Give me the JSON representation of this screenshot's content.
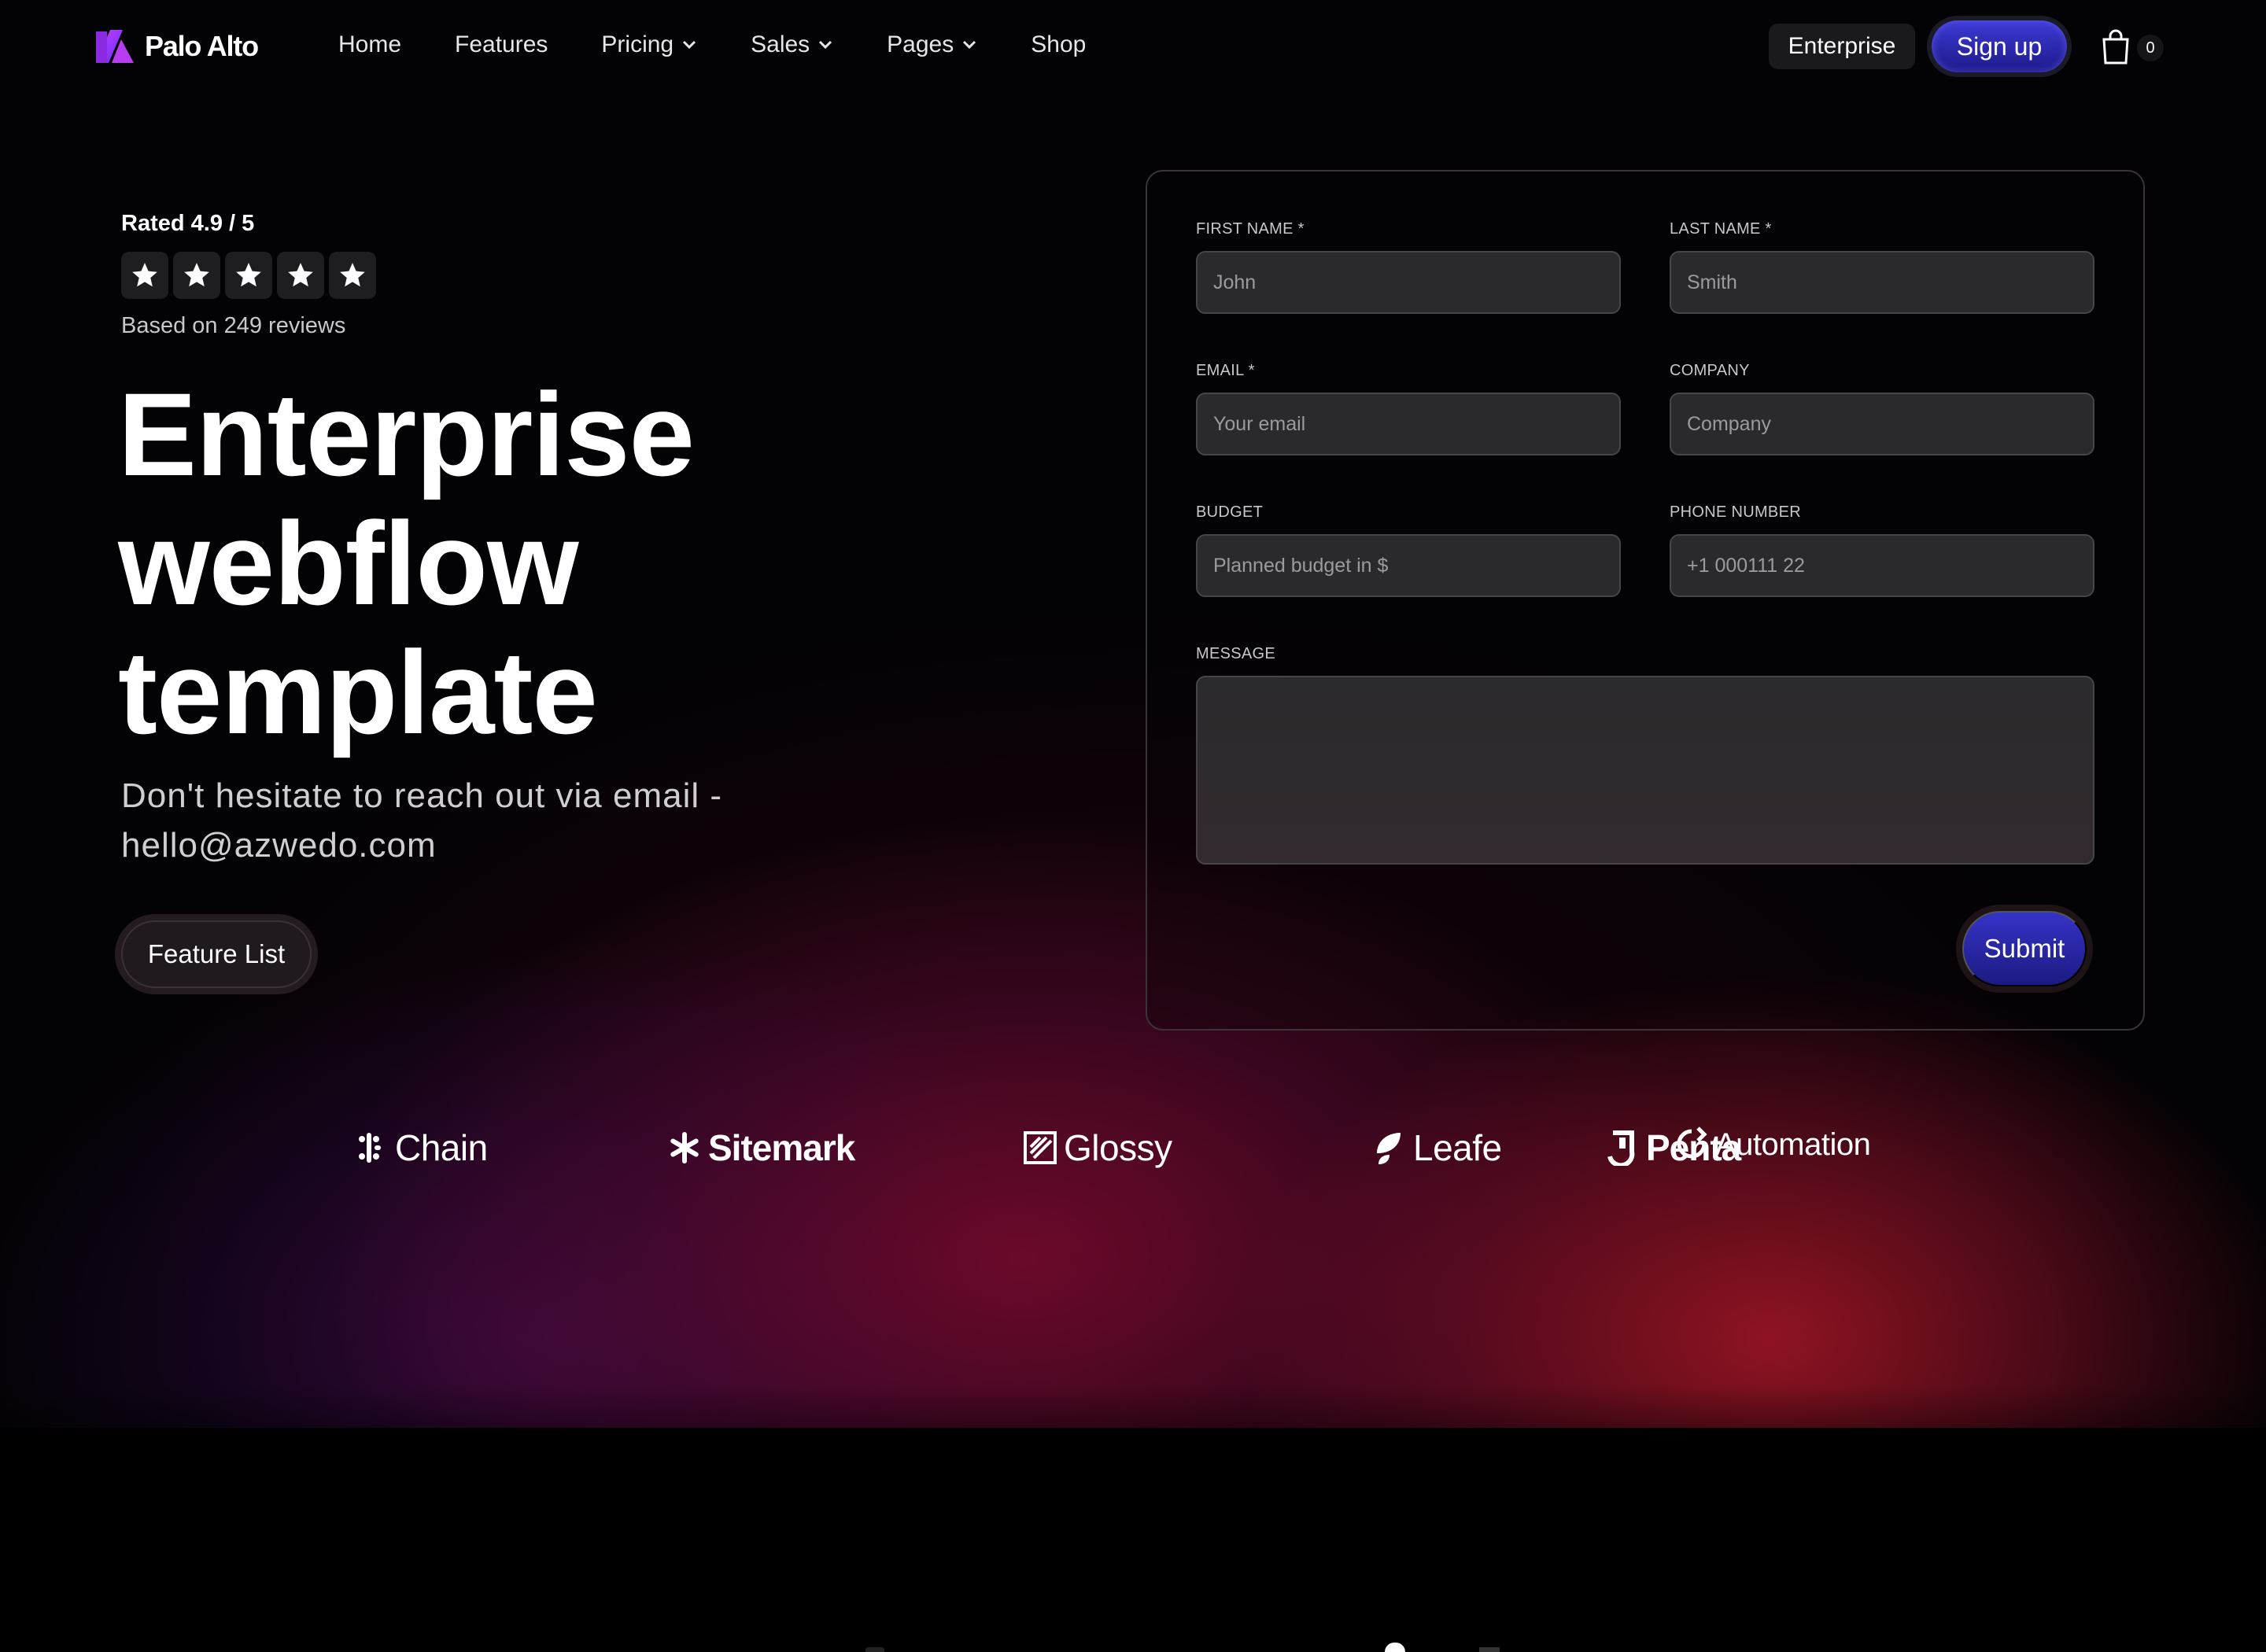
{
  "nav": {
    "brand": "Palo Alto",
    "links": [
      {
        "label": "Home",
        "dropdown": false
      },
      {
        "label": "Features",
        "dropdown": false
      },
      {
        "label": "Pricing",
        "dropdown": true
      },
      {
        "label": "Sales",
        "dropdown": true
      },
      {
        "label": "Pages",
        "dropdown": true
      },
      {
        "label": "Shop",
        "dropdown": false
      }
    ],
    "enterprise_label": "Enterprise",
    "signup_label": "Sign up",
    "cart_count": "0"
  },
  "hero": {
    "rating_text": "Rated 4.9 / 5",
    "stars": 5,
    "reviews_text": "Based on 249 reviews",
    "headline_lines": [
      "Enterprise",
      "webflow",
      "template"
    ],
    "subtext": "Don't hesitate to reach out via email - hello@azwedo.com",
    "feature_button": "Feature List"
  },
  "form": {
    "first_name": {
      "label": "FIRST NAME *",
      "placeholder": "John"
    },
    "last_name": {
      "label": "LAST NAME *",
      "placeholder": "Smith"
    },
    "email": {
      "label": "EMAIL *",
      "placeholder": "Your email"
    },
    "company": {
      "label": "COMPANY",
      "placeholder": "Company"
    },
    "budget": {
      "label": "BUDGET",
      "placeholder": "Planned budget in $"
    },
    "phone": {
      "label": "PHONE NUMBER",
      "placeholder": "+1 000111 22"
    },
    "message": {
      "label": "MESSAGE",
      "placeholder": ""
    },
    "submit_label": "Submit"
  },
  "brands": {
    "chain": "Chain",
    "sitemark": "Sitemark",
    "glossy": "Glossy",
    "leafe": "Leafe",
    "penta": "Penta",
    "automation": "Automation"
  },
  "colors": {
    "accent_button": "#2e2bb8",
    "background": "#000000",
    "gradient_red": "#8a1420",
    "gradient_purple": "#3c0a4a"
  }
}
